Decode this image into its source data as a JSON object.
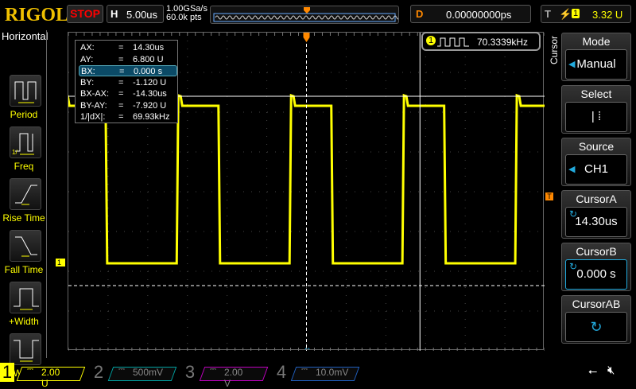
{
  "header": {
    "logo": "RIGOL",
    "run_state": "STOP",
    "h_label": "H",
    "timebase": "5.00us",
    "sample_rate": "1.00GSa/s",
    "memory_depth": "60.0k pts",
    "d_label": "D",
    "delay": "0.00000000ps",
    "t_label": "T",
    "trigger_source": "1",
    "trigger_level": "3.32 U"
  },
  "left_menu": {
    "title": "Horizontal",
    "items": [
      {
        "label": "Period"
      },
      {
        "label": "Freq"
      },
      {
        "label": "Rise Time"
      },
      {
        "label": "Fall Time"
      },
      {
        "label": "+Width"
      },
      {
        "label": "-Width"
      }
    ]
  },
  "cursor_readout": [
    {
      "name": "AX:",
      "eq": "=",
      "value": "14.30us"
    },
    {
      "name": "AY:",
      "eq": "=",
      "value": "6.800 U"
    },
    {
      "name": "BX:",
      "eq": "=",
      "value": "0.000 s"
    },
    {
      "name": "BY:",
      "eq": "=",
      "value": "-1.120 U"
    },
    {
      "name": "BX-AX:",
      "eq": "=",
      "value": "-14.30us"
    },
    {
      "name": "BY-AY:",
      "eq": "=",
      "value": "-7.920 U"
    },
    {
      "name": "1/|dX|:",
      "eq": "=",
      "value": "69.93kHz"
    }
  ],
  "freq_counter": {
    "channel": "1",
    "value": "70.3339kHz"
  },
  "right_menu": {
    "title": "Cursor",
    "items": [
      {
        "label": "Mode",
        "value": "Manual"
      },
      {
        "label": "Select",
        "value": "|  ⁞"
      },
      {
        "label": "Source",
        "value": "CH1"
      },
      {
        "label": "CursorA",
        "value": "14.30us"
      },
      {
        "label": "CursorB",
        "value": "0.000 s"
      },
      {
        "label": "CursorAB",
        "value": ""
      }
    ]
  },
  "markers": {
    "ch1": "1",
    "trigger": "T"
  },
  "channels": [
    {
      "num": "1",
      "scale": "2.00 U",
      "color": "#ffff00",
      "active": true
    },
    {
      "num": "2",
      "scale": "500mV",
      "color": "#00a0a0",
      "active": false
    },
    {
      "num": "3",
      "scale": "2.00 V",
      "color": "#c000c0",
      "active": false
    },
    {
      "num": "4",
      "scale": "10.0mV",
      "color": "#2060c0",
      "active": false
    }
  ],
  "waveform": {
    "frequency_khz": 70.3339,
    "high_v": 6.8,
    "low_v": -1.12,
    "volts_per_div": 2.0,
    "us_per_div": 5.0,
    "cursor_ax_us": 14.3,
    "cursor_bx_us": 0.0,
    "cursor_ay_v": 6.8,
    "cursor_by_v": -1.12,
    "ch1_offset_v": -1.1
  }
}
